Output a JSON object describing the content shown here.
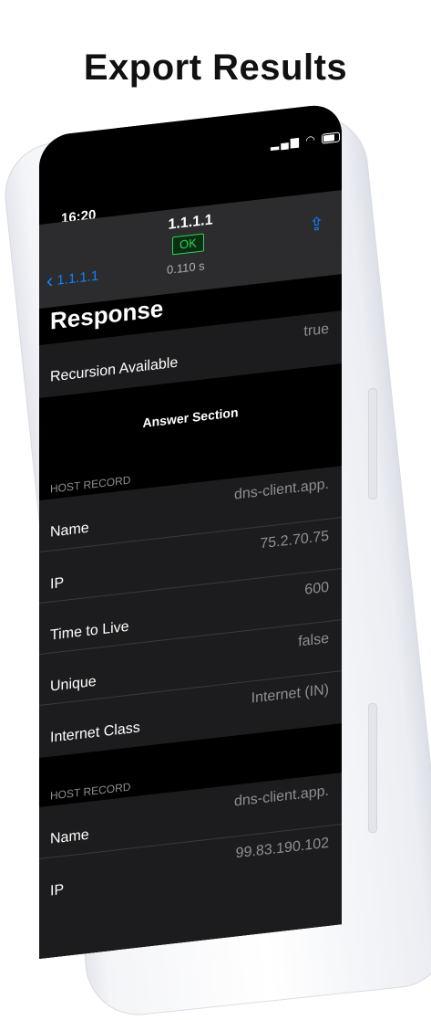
{
  "headline": "Export Results",
  "status": {
    "time": "16:20"
  },
  "nav": {
    "title": "1.1.1.1",
    "back_label": "1.1.1.1"
  },
  "result": {
    "status_badge": "OK",
    "latency": "0.110 s"
  },
  "response": {
    "title": "Response",
    "rows": [
      {
        "key": "Recursion Available",
        "value": "true"
      }
    ]
  },
  "answer_section": {
    "title": "Answer Section"
  },
  "records": [
    {
      "label": "HOST RECORD",
      "rows": [
        {
          "key": "Name",
          "value": "dns-client.app."
        },
        {
          "key": "IP",
          "value": "75.2.70.75"
        },
        {
          "key": "Time to Live",
          "value": "600"
        },
        {
          "key": "Unique",
          "value": "false"
        },
        {
          "key": "Internet Class",
          "value": "Internet (IN)"
        }
      ]
    },
    {
      "label": "HOST RECORD",
      "rows": [
        {
          "key": "Name",
          "value": "dns-client.app."
        },
        {
          "key": "IP",
          "value": "99.83.190.102"
        }
      ]
    }
  ],
  "colors": {
    "accent": "#0a84ff",
    "ok": "#2fd158",
    "background": "#000000",
    "cell": "#1c1c1e"
  }
}
